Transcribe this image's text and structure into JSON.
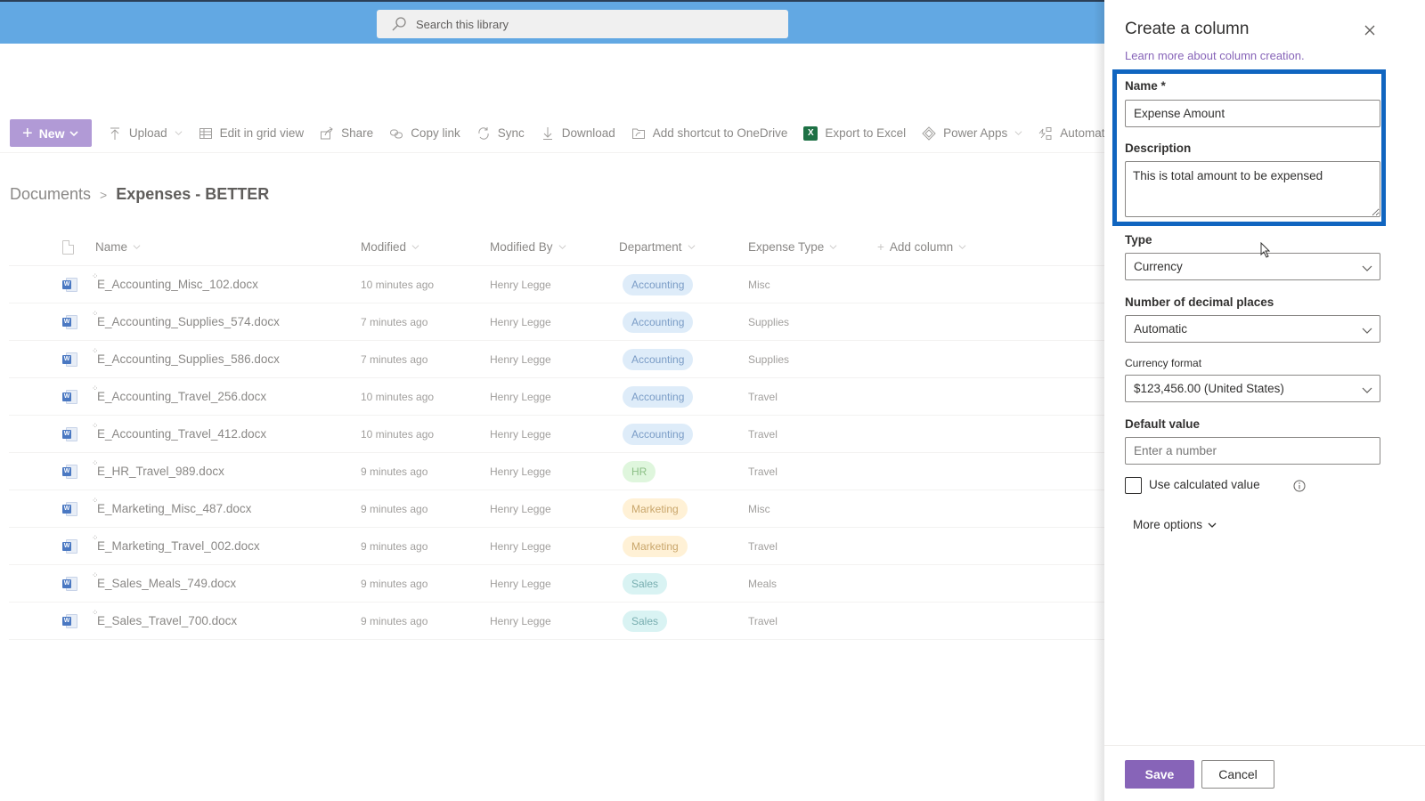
{
  "search": {
    "placeholder": "Search this library"
  },
  "commandbar": {
    "new_label": "New",
    "items": [
      {
        "label": "Upload",
        "icon": "upload-icon",
        "dropdown": true
      },
      {
        "label": "Edit in grid view",
        "icon": "grid-icon",
        "dropdown": false
      },
      {
        "label": "Share",
        "icon": "share-icon",
        "dropdown": false
      },
      {
        "label": "Copy link",
        "icon": "link-icon",
        "dropdown": false
      },
      {
        "label": "Sync",
        "icon": "sync-icon",
        "dropdown": false
      },
      {
        "label": "Download",
        "icon": "download-icon",
        "dropdown": false
      },
      {
        "label": "Add shortcut to OneDrive",
        "icon": "shortcut-icon",
        "dropdown": false
      },
      {
        "label": "Export to Excel",
        "icon": "excel-icon",
        "dropdown": false
      },
      {
        "label": "Power Apps",
        "icon": "powerapps-icon",
        "dropdown": true
      },
      {
        "label": "Automate",
        "icon": "automate-icon",
        "dropdown": true
      }
    ]
  },
  "breadcrumb": {
    "root": "Documents",
    "current": "Expenses - BETTER"
  },
  "table": {
    "headers": {
      "name": "Name",
      "modified": "Modified",
      "modified_by": "Modified By",
      "department": "Department",
      "expense_type": "Expense Type",
      "add_column": "Add column"
    },
    "rows": [
      {
        "name": "E_Accounting_Misc_102.docx",
        "modified": "10 minutes ago",
        "modified_by": "Henry Legge",
        "department": "Accounting",
        "expense_type": "Misc"
      },
      {
        "name": "E_Accounting_Supplies_574.docx",
        "modified": "7 minutes ago",
        "modified_by": "Henry Legge",
        "department": "Accounting",
        "expense_type": "Supplies"
      },
      {
        "name": "E_Accounting_Supplies_586.docx",
        "modified": "7 minutes ago",
        "modified_by": "Henry Legge",
        "department": "Accounting",
        "expense_type": "Supplies"
      },
      {
        "name": "E_Accounting_Travel_256.docx",
        "modified": "10 minutes ago",
        "modified_by": "Henry Legge",
        "department": "Accounting",
        "expense_type": "Travel"
      },
      {
        "name": "E_Accounting_Travel_412.docx",
        "modified": "10 minutes ago",
        "modified_by": "Henry Legge",
        "department": "Accounting",
        "expense_type": "Travel"
      },
      {
        "name": "E_HR_Travel_989.docx",
        "modified": "9 minutes ago",
        "modified_by": "Henry Legge",
        "department": "HR",
        "expense_type": "Travel"
      },
      {
        "name": "E_Marketing_Misc_487.docx",
        "modified": "9 minutes ago",
        "modified_by": "Henry Legge",
        "department": "Marketing",
        "expense_type": "Misc"
      },
      {
        "name": "E_Marketing_Travel_002.docx",
        "modified": "9 minutes ago",
        "modified_by": "Henry Legge",
        "department": "Marketing",
        "expense_type": "Travel"
      },
      {
        "name": "E_Sales_Meals_749.docx",
        "modified": "9 minutes ago",
        "modified_by": "Henry Legge",
        "department": "Sales",
        "expense_type": "Meals"
      },
      {
        "name": "E_Sales_Travel_700.docx",
        "modified": "9 minutes ago",
        "modified_by": "Henry Legge",
        "department": "Sales",
        "expense_type": "Travel"
      }
    ]
  },
  "department_colors": {
    "Accounting": {
      "bg": "#deecf9",
      "fg": "#7a9cc6"
    },
    "HR": {
      "bg": "#dff6dd",
      "fg": "#8cbf86"
    },
    "Marketing": {
      "bg": "#fff1d6",
      "fg": "#c9a66b"
    },
    "Sales": {
      "bg": "#d9f3f3",
      "fg": "#78aeb0"
    }
  },
  "panel": {
    "title": "Create a column",
    "learn_more": "Learn more about column creation.",
    "name_label": "Name *",
    "name_value": "Expense Amount",
    "description_label": "Description",
    "description_value": "This is total amount to be expensed",
    "type_label": "Type",
    "type_value": "Currency",
    "decimals_label": "Number of decimal places",
    "decimals_value": "Automatic",
    "currency_format_label": "Currency format",
    "currency_format_value": "$123,456.00 (United States)",
    "default_value_label": "Default value",
    "default_value_placeholder": "Enter a number",
    "use_calculated_label": "Use calculated value",
    "use_calculated_checked": false,
    "more_options": "More options",
    "save": "Save",
    "cancel": "Cancel"
  },
  "colors": {
    "accent": "#8764b8",
    "highlight": "#1065c0",
    "topbar": "#62a8e3"
  }
}
